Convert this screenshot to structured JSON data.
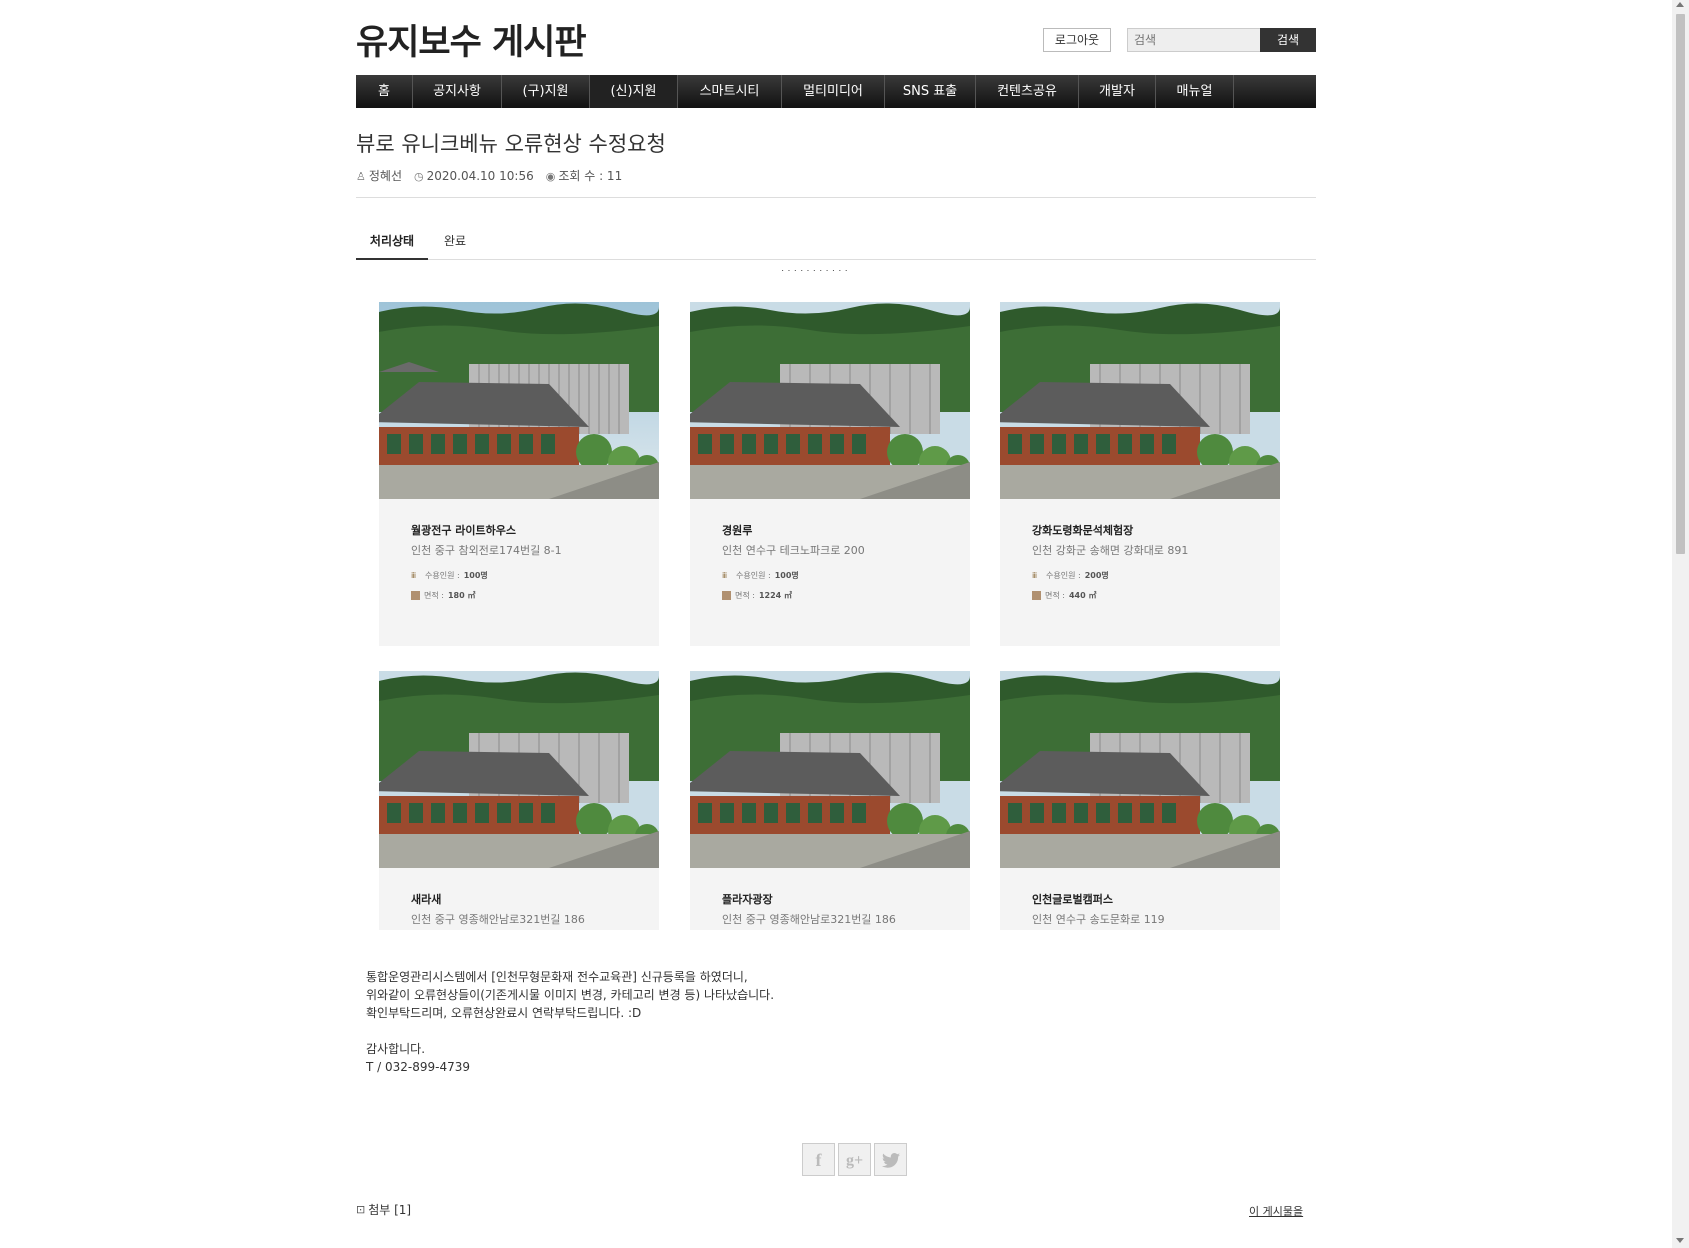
{
  "header": {
    "site_title": "유지보수 게시판",
    "logout_label": "로그아웃",
    "search_placeholder": "검색",
    "search_button": "검색"
  },
  "nav": {
    "items": [
      {
        "label": "홈"
      },
      {
        "label": "공지사항"
      },
      {
        "label": "(구)지원"
      },
      {
        "label": "(신)지원"
      },
      {
        "label": "스마트시티"
      },
      {
        "label": "멀티미디어"
      },
      {
        "label": "SNS 표출"
      },
      {
        "label": "컨텐츠공유"
      },
      {
        "label": "개발자"
      },
      {
        "label": "매뉴얼"
      }
    ]
  },
  "post": {
    "title": "뷰로 유니크베뉴 오류현상 수정요청",
    "author": "정혜선",
    "datetime": "2020.04.10 10:56",
    "views": "조회 수 : 11",
    "status_label": "처리상태",
    "status_value": "완료"
  },
  "cards": [
    {
      "name": "월광전구 라이트하우스",
      "address": "인천 중구 참외전로174번길 8-1",
      "capacity_label": "수용인원 :",
      "capacity": "100명",
      "area_label": "면적 :",
      "area": "180 ㎡"
    },
    {
      "name": "경원루",
      "address": "인천 연수구 테크노파크로 200",
      "capacity_label": "수용인원 :",
      "capacity": "100명",
      "area_label": "면적 :",
      "area": "1224 ㎡"
    },
    {
      "name": "강화도령화문석체험장",
      "address": "인천 강화군 송해면 강화대로 891",
      "capacity_label": "수용인원 :",
      "capacity": "200명",
      "area_label": "면적 :",
      "area": "440 ㎡"
    },
    {
      "name": "새라새",
      "address": "인천 중구 영종해안남로321번길 186"
    },
    {
      "name": "플라자광장",
      "address": "인천 중구 영종해안남로321번길 186"
    },
    {
      "name": "인천글로벌캠퍼스",
      "address": "인천 연수구 송도문화로 119"
    }
  ],
  "body": {
    "line1": "통합운영관리시스템에서 [인천무형문화재 전수교육관] 신규등록을 하였더니,",
    "line2": "위와같이 오류현상들이(기존게시물 이미지 변경, 카테고리 변경 등) 나타났습니다.",
    "line3": "확인부탁드리며, 오류현상완료시 연락부탁드립니다. :D",
    "line4": "감사합니다.",
    "line5": "T / 032-899-4739"
  },
  "share": {
    "facebook": "f",
    "google": "g+",
    "twitter": "t"
  },
  "footer": {
    "attach_label": "첨부 [1]",
    "this_post_label": "이 게시물을"
  }
}
